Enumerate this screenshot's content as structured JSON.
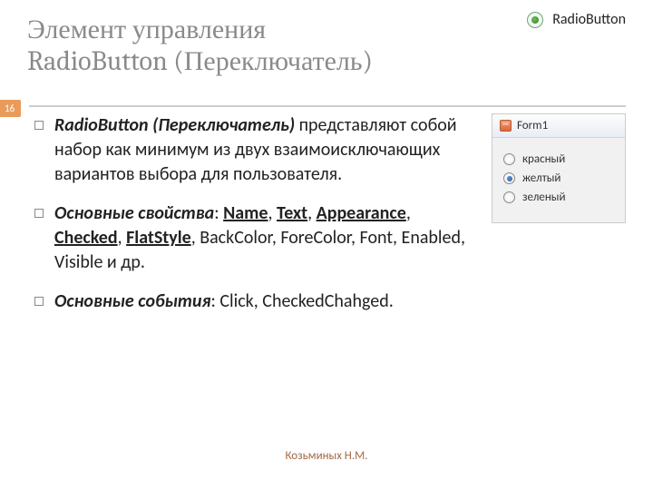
{
  "title_line1": "Элемент управления",
  "title_line2": "RadioButton (Переключатель)",
  "page_number": "16",
  "header_radio_label": "RadioButton",
  "bullets": {
    "b1_strong": "RadioButton (Переключатель)",
    "b1_rest": " представляют собой набор как минимум из двух взаимоисключающих вариантов выбора для пользователя.",
    "b2_lead": "Основные свойства",
    "b2_colon": ": ",
    "b2_props_u": [
      "Name",
      "Text",
      "Appearance",
      "Checked",
      "FlatStyle"
    ],
    "b2_props_plain": "BackColor, ForeColor, Font, Enabled, Visible и др.",
    "b3_lead": "Основные события",
    "b3_rest": ": Click, CheckedChahged."
  },
  "form": {
    "title": "Form1",
    "options": [
      {
        "label": "красный",
        "checked": false
      },
      {
        "label": "желтый",
        "checked": true
      },
      {
        "label": "зеленый",
        "checked": false
      }
    ]
  },
  "footer": "Козьминых Н.М."
}
